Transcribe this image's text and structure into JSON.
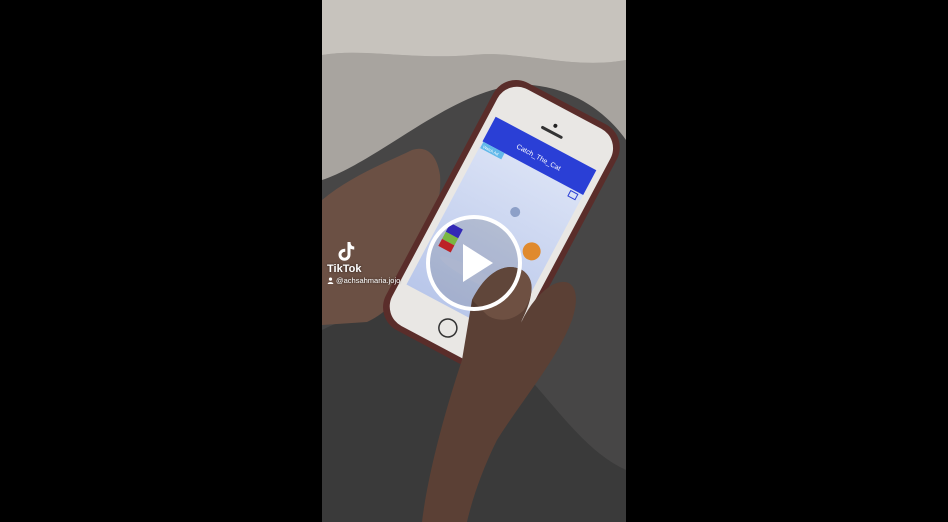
{
  "tiktok": {
    "brand": "TikTok",
    "username": "@achsahmaria.jojo"
  },
  "phone_screen": {
    "app_title": "Catch_The_Cat",
    "corner_label": "Watch Ad"
  },
  "icons": {
    "play": "play-icon",
    "logo": "tiktok-logo-icon",
    "user": "user-icon"
  },
  "colors": {
    "app_bar": "#2a3fd6",
    "page_bg": "#000000",
    "phone_case": "#5a2d2a"
  }
}
